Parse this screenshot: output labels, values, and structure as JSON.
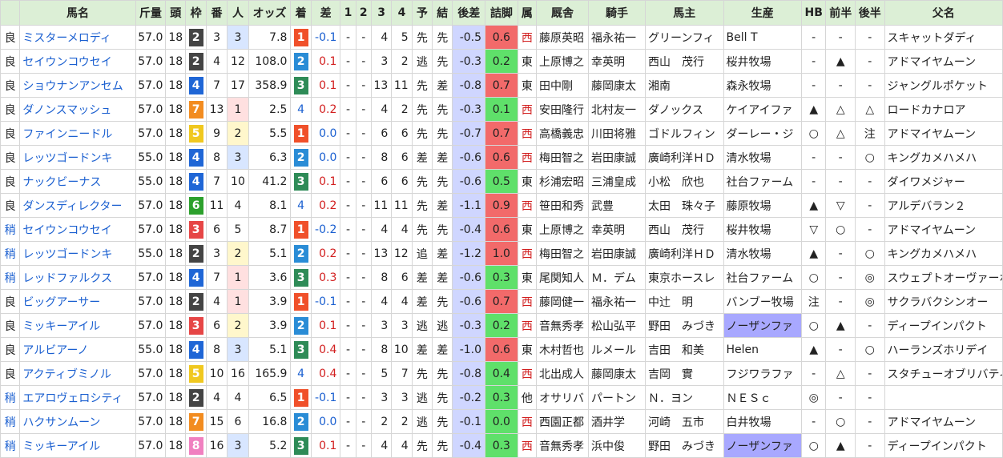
{
  "colors": {
    "header_bg": "#dcefd6",
    "waku": {
      "1": "#ffffff",
      "2": "#444444",
      "3": "#e64646",
      "4": "#1f66d6",
      "5": "#f0c820",
      "6": "#2ca02c",
      "7": "#f28c20",
      "8": "#f080c0"
    },
    "finish": {
      "1": "#f0502a",
      "2": "#2a8cd6",
      "3": "#2e8b57",
      "4": "#ffffff"
    },
    "pop_low_bg": {
      "1": "#ffe0e0",
      "2": "#fff7cc",
      "3": "#d8e6ff"
    }
  },
  "header": {
    "cols": [
      "",
      "馬名",
      "斤量",
      "頭",
      "枠",
      "番",
      "人",
      "オッズ",
      "着",
      "差",
      "1",
      "2",
      "3",
      "4",
      "予",
      "結",
      "後差",
      "詰脚",
      "属",
      "厩舎",
      "騎手",
      "馬主",
      "生産",
      "HB",
      "前半",
      "後半",
      "父名"
    ]
  },
  "rows": [
    {
      "cond": "良",
      "name": "ミスターメロディ",
      "kin": "57.0",
      "tou": "18",
      "waku": "2",
      "ban": "3",
      "pop": "3",
      "odds": "7.8",
      "rank": "1",
      "diff": "-0.1",
      "p1": "-",
      "p2": "-",
      "p3": "4",
      "p4": "5",
      "yo": "先",
      "ke": "先",
      "ato": "-0.5",
      "tsume": "0.6",
      "zoku": "西",
      "stable": "藤原英昭",
      "jockey": "福永祐一",
      "owner": "グリーンフィ",
      "farm": "Bell T",
      "hb": "-",
      "zen": "-",
      "kou": "-",
      "sire": "スキャットダディ"
    },
    {
      "cond": "良",
      "name": "セイウンコウセイ",
      "kin": "57.0",
      "tou": "18",
      "waku": "2",
      "ban": "4",
      "pop": "12",
      "odds": "108.0",
      "rank": "2",
      "diff": "0.1",
      "p1": "-",
      "p2": "-",
      "p3": "3",
      "p4": "2",
      "yo": "逃",
      "ke": "先",
      "ato": "-0.3",
      "tsume": "0.2",
      "zoku": "東",
      "stable": "上原博之",
      "jockey": "幸英明",
      "owner": "西山　茂行",
      "farm": "桜井牧場",
      "hb": "-",
      "zen": "▲",
      "kou": "-",
      "sire": "アドマイヤムーン"
    },
    {
      "cond": "良",
      "name": "ショウナンアンセム",
      "kin": "57.0",
      "tou": "18",
      "waku": "4",
      "ban": "7",
      "pop": "17",
      "odds": "358.9",
      "rank": "3",
      "diff": "0.1",
      "p1": "-",
      "p2": "-",
      "p3": "13",
      "p4": "11",
      "yo": "先",
      "ke": "差",
      "ato": "-0.8",
      "tsume": "0.7",
      "zoku": "東",
      "stable": "田中剛",
      "jockey": "藤岡康太",
      "owner": "湘南",
      "farm": "森永牧場",
      "hb": "-",
      "zen": "-",
      "kou": "-",
      "sire": "ジャングルポケット"
    },
    {
      "cond": "良",
      "name": "ダノンスマッシュ",
      "kin": "57.0",
      "tou": "18",
      "waku": "7",
      "ban": "13",
      "pop": "1",
      "odds": "2.5",
      "rank": "4",
      "diff": "0.2",
      "p1": "-",
      "p2": "-",
      "p3": "4",
      "p4": "2",
      "yo": "先",
      "ke": "先",
      "ato": "-0.3",
      "tsume": "0.1",
      "zoku": "西",
      "stable": "安田隆行",
      "jockey": "北村友一",
      "owner": "ダノックス",
      "farm": "ケイアイファ",
      "hb": "▲",
      "zen": "△",
      "kou": "△",
      "sire": "ロードカナロア"
    },
    {
      "cond": "良",
      "name": "ファインニードル",
      "kin": "57.0",
      "tou": "18",
      "waku": "5",
      "ban": "9",
      "pop": "2",
      "odds": "5.5",
      "rank": "1",
      "diff": "0.0",
      "p1": "-",
      "p2": "-",
      "p3": "6",
      "p4": "6",
      "yo": "先",
      "ke": "先",
      "ato": "-0.7",
      "tsume": "0.7",
      "zoku": "西",
      "stable": "高橋義忠",
      "jockey": "川田将雅",
      "owner": "ゴドルフィン",
      "farm": "ダーレー・ジ",
      "hb": "○",
      "zen": "△",
      "kou": "注",
      "sire": "アドマイヤムーン"
    },
    {
      "cond": "良",
      "name": "レッツゴードンキ",
      "kin": "55.0",
      "tou": "18",
      "waku": "4",
      "ban": "8",
      "pop": "3",
      "odds": "6.3",
      "rank": "2",
      "diff": "0.0",
      "p1": "-",
      "p2": "-",
      "p3": "8",
      "p4": "6",
      "yo": "差",
      "ke": "差",
      "ato": "-0.6",
      "tsume": "0.6",
      "zoku": "西",
      "stable": "梅田智之",
      "jockey": "岩田康誠",
      "owner": "廣崎利洋ＨＤ",
      "farm": "清水牧場",
      "hb": "-",
      "zen": "-",
      "kou": "○",
      "sire": "キングカメハメハ"
    },
    {
      "cond": "良",
      "name": "ナックビーナス",
      "kin": "55.0",
      "tou": "18",
      "waku": "4",
      "ban": "7",
      "pop": "10",
      "odds": "41.2",
      "rank": "3",
      "diff": "0.1",
      "p1": "-",
      "p2": "-",
      "p3": "6",
      "p4": "6",
      "yo": "先",
      "ke": "先",
      "ato": "-0.6",
      "tsume": "0.5",
      "zoku": "東",
      "stable": "杉浦宏昭",
      "jockey": "三浦皇成",
      "owner": "小松　欣也",
      "farm": "社台ファーム",
      "hb": "-",
      "zen": "-",
      "kou": "-",
      "sire": "ダイワメジャー"
    },
    {
      "cond": "良",
      "name": "ダンスディレクター",
      "kin": "57.0",
      "tou": "18",
      "waku": "6",
      "ban": "11",
      "pop": "4",
      "odds": "8.1",
      "rank": "4",
      "diff": "0.2",
      "p1": "-",
      "p2": "-",
      "p3": "11",
      "p4": "11",
      "yo": "先",
      "ke": "差",
      "ato": "-1.1",
      "tsume": "0.9",
      "zoku": "西",
      "stable": "笹田和秀",
      "jockey": "武豊",
      "owner": "太田　珠々子",
      "farm": "藤原牧場",
      "hb": "▲",
      "zen": "▽",
      "kou": "-",
      "sire": "アルデバラン２"
    },
    {
      "cond": "稍",
      "name": "セイウンコウセイ",
      "kin": "57.0",
      "tou": "18",
      "waku": "3",
      "ban": "6",
      "pop": "5",
      "odds": "8.7",
      "rank": "1",
      "diff": "-0.2",
      "p1": "-",
      "p2": "-",
      "p3": "4",
      "p4": "4",
      "yo": "先",
      "ke": "先",
      "ato": "-0.4",
      "tsume": "0.6",
      "zoku": "東",
      "stable": "上原博之",
      "jockey": "幸英明",
      "owner": "西山　茂行",
      "farm": "桜井牧場",
      "hb": "▽",
      "zen": "○",
      "kou": "-",
      "sire": "アドマイヤムーン"
    },
    {
      "cond": "稍",
      "name": "レッツゴードンキ",
      "kin": "55.0",
      "tou": "18",
      "waku": "2",
      "ban": "3",
      "pop": "2",
      "odds": "5.1",
      "rank": "2",
      "diff": "0.2",
      "p1": "-",
      "p2": "-",
      "p3": "13",
      "p4": "12",
      "yo": "追",
      "ke": "差",
      "ato": "-1.2",
      "tsume": "1.0",
      "zoku": "西",
      "stable": "梅田智之",
      "jockey": "岩田康誠",
      "owner": "廣崎利洋ＨＤ",
      "farm": "清水牧場",
      "hb": "▲",
      "zen": "-",
      "kou": "○",
      "sire": "キングカメハメハ"
    },
    {
      "cond": "稍",
      "name": "レッドファルクス",
      "kin": "57.0",
      "tou": "18",
      "waku": "4",
      "ban": "7",
      "pop": "1",
      "odds": "3.6",
      "rank": "3",
      "diff": "0.3",
      "p1": "-",
      "p2": "-",
      "p3": "8",
      "p4": "6",
      "yo": "差",
      "ke": "差",
      "ato": "-0.6",
      "tsume": "0.3",
      "zoku": "東",
      "stable": "尾関知人",
      "jockey": "Ｍ．デム",
      "owner": "東京ホースレ",
      "farm": "社台ファーム",
      "hb": "○",
      "zen": "-",
      "kou": "◎",
      "sire": "スウェプトオーヴァーボード"
    },
    {
      "cond": "良",
      "name": "ビッグアーサー",
      "kin": "57.0",
      "tou": "18",
      "waku": "2",
      "ban": "4",
      "pop": "1",
      "odds": "3.9",
      "rank": "1",
      "diff": "-0.1",
      "p1": "-",
      "p2": "-",
      "p3": "4",
      "p4": "4",
      "yo": "差",
      "ke": "先",
      "ato": "-0.6",
      "tsume": "0.7",
      "zoku": "西",
      "stable": "藤岡健一",
      "jockey": "福永祐一",
      "owner": "中辻　明",
      "farm": "バンブー牧場",
      "hb": "注",
      "zen": "-",
      "kou": "◎",
      "sire": "サクラバクシンオー"
    },
    {
      "cond": "良",
      "name": "ミッキーアイル",
      "kin": "57.0",
      "tou": "18",
      "waku": "3",
      "ban": "6",
      "pop": "2",
      "odds": "3.9",
      "rank": "2",
      "diff": "0.1",
      "p1": "-",
      "p2": "-",
      "p3": "3",
      "p4": "3",
      "yo": "逃",
      "ke": "逃",
      "ato": "-0.3",
      "tsume": "0.2",
      "zoku": "西",
      "stable": "音無秀孝",
      "jockey": "松山弘平",
      "owner": "野田　みづき",
      "farm": "ノーザンファ",
      "hb": "○",
      "zen": "▲",
      "kou": "-",
      "sire": "ディープインパクト"
    },
    {
      "cond": "良",
      "name": "アルビアーノ",
      "kin": "55.0",
      "tou": "18",
      "waku": "4",
      "ban": "8",
      "pop": "3",
      "odds": "5.1",
      "rank": "3",
      "diff": "0.4",
      "p1": "-",
      "p2": "-",
      "p3": "8",
      "p4": "10",
      "yo": "差",
      "ke": "差",
      "ato": "-1.0",
      "tsume": "0.6",
      "zoku": "東",
      "stable": "木村哲也",
      "jockey": "ルメール",
      "owner": "吉田　和美",
      "farm": "Helen",
      "hb": "▲",
      "zen": "-",
      "kou": "○",
      "sire": "ハーランズホリデイ"
    },
    {
      "cond": "良",
      "name": "アクティブミノル",
      "kin": "57.0",
      "tou": "18",
      "waku": "5",
      "ban": "10",
      "pop": "16",
      "odds": "165.9",
      "rank": "4",
      "diff": "0.4",
      "p1": "-",
      "p2": "-",
      "p3": "5",
      "p4": "7",
      "yo": "先",
      "ke": "先",
      "ato": "-0.8",
      "tsume": "0.4",
      "zoku": "西",
      "stable": "北出成人",
      "jockey": "藤岡康太",
      "owner": "吉岡　實",
      "farm": "フジワラファ",
      "hb": "-",
      "zen": "△",
      "kou": "-",
      "sire": "スタチューオブリバティ"
    },
    {
      "cond": "稍",
      "name": "エアロヴェロシティ",
      "kin": "57.0",
      "tou": "18",
      "waku": "2",
      "ban": "4",
      "pop": "4",
      "odds": "6.5",
      "rank": "1",
      "diff": "-0.1",
      "p1": "-",
      "p2": "-",
      "p3": "3",
      "p4": "3",
      "yo": "逃",
      "ke": "先",
      "ato": "-0.2",
      "tsume": "0.3",
      "zoku": "他",
      "stable": "オサリバ",
      "jockey": "パートン",
      "owner": "Ｎ．ヨン",
      "farm": "ＮＥＳｃ",
      "hb": "◎",
      "zen": "-",
      "kou": "-",
      "sire": ""
    },
    {
      "cond": "稍",
      "name": "ハクサンムーン",
      "kin": "57.0",
      "tou": "18",
      "waku": "7",
      "ban": "15",
      "pop": "6",
      "odds": "16.8",
      "rank": "2",
      "diff": "0.0",
      "p1": "-",
      "p2": "-",
      "p3": "2",
      "p4": "2",
      "yo": "逃",
      "ke": "先",
      "ato": "-0.1",
      "tsume": "0.0",
      "zoku": "西",
      "stable": "西園正都",
      "jockey": "酒井学",
      "owner": "河崎　五市",
      "farm": "白井牧場",
      "hb": "-",
      "zen": "○",
      "kou": "-",
      "sire": "アドマイヤムーン"
    },
    {
      "cond": "稍",
      "name": "ミッキーアイル",
      "kin": "57.0",
      "tou": "18",
      "waku": "8",
      "ban": "16",
      "pop": "3",
      "odds": "5.2",
      "rank": "3",
      "diff": "0.1",
      "p1": "-",
      "p2": "-",
      "p3": "4",
      "p4": "4",
      "yo": "先",
      "ke": "先",
      "ato": "-0.4",
      "tsume": "0.3",
      "zoku": "西",
      "stable": "音無秀孝",
      "jockey": "浜中俊",
      "owner": "野田　みづき",
      "farm": "ノーザンファ",
      "hb": "○",
      "zen": "▲",
      "kou": "-",
      "sire": "ディープインパクト"
    }
  ]
}
